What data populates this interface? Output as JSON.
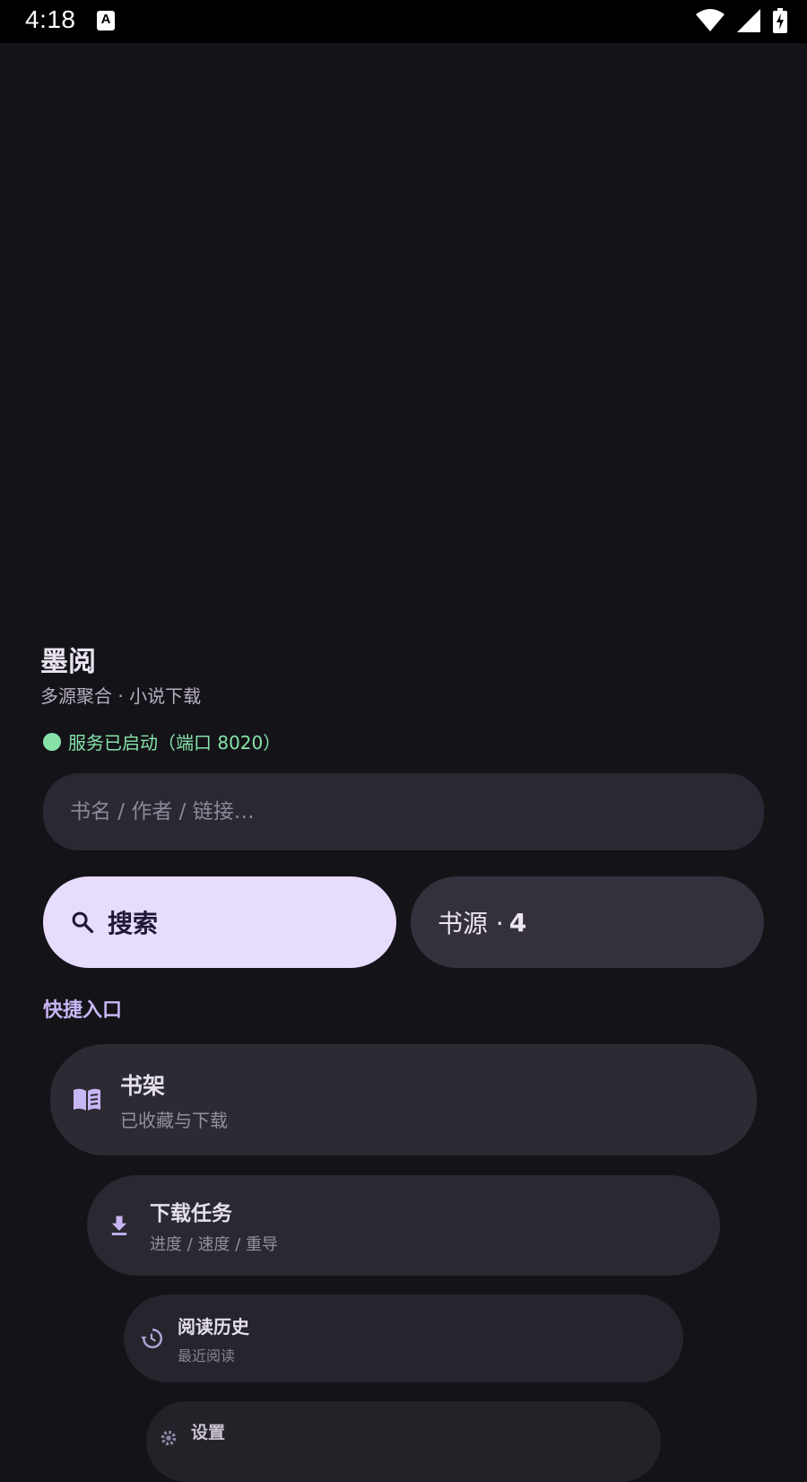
{
  "statusbar": {
    "time": "4:18",
    "notification_icon_letter": "A"
  },
  "header": {
    "title": "墨阅",
    "subtitle": "多源聚合 · 小说下载",
    "service_status": "服务已启动（端口 8020）",
    "status_color": "#86e2a9"
  },
  "search": {
    "placeholder": "书名 / 作者 / 链接…",
    "value": "",
    "search_button_label": "搜索",
    "sources_button_label": "书源 ·",
    "sources_count": "4"
  },
  "quick_entry": {
    "section_label": "快捷入口",
    "items": [
      {
        "title": "书架",
        "subtitle": "已收藏与下载",
        "icon": "book-open-icon"
      },
      {
        "title": "下载任务",
        "subtitle": "进度 / 速度 / 重导",
        "icon": "download-icon"
      },
      {
        "title": "阅读历史",
        "subtitle": "最近阅读",
        "icon": "history-icon"
      },
      {
        "title": "设置",
        "subtitle": "",
        "icon": "gear-icon"
      }
    ]
  },
  "colors": {
    "background": "#141318",
    "accent": "#c8b6f5",
    "primary_button": "#e7dcfc"
  }
}
